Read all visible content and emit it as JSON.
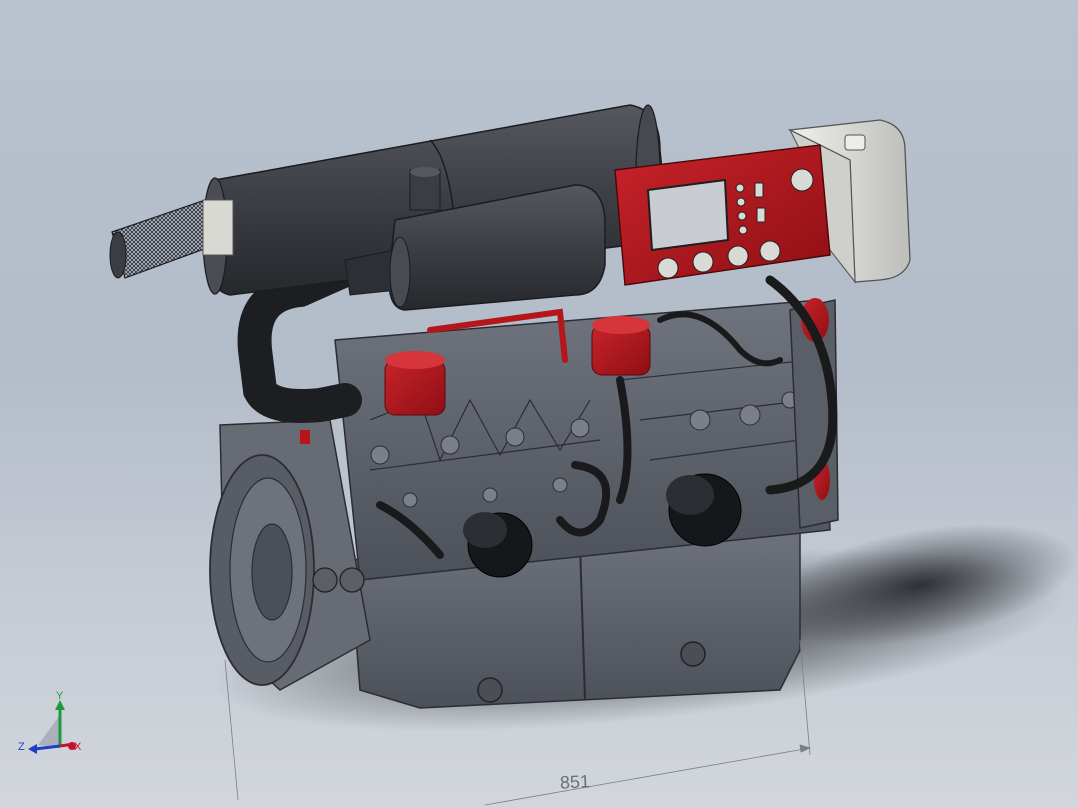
{
  "viewport": {
    "background_top": "#b9c2cf",
    "background_bottom": "#d2d6dc"
  },
  "model": {
    "colors": {
      "body": "#5c606a",
      "dark": "#2f3238",
      "muffler": "#3b3e44",
      "accent_red": "#b5161c",
      "hose": "#1a1a1d",
      "tank": "#d9d9d6",
      "screen": "#c9ccd0"
    }
  },
  "dimension": {
    "value": "851"
  },
  "triad": {
    "x_label": "X",
    "y_label": "Y",
    "z_label": "Z",
    "x_color": "#c8102e",
    "y_color": "#1f9a3a",
    "z_color": "#1c3fc4"
  }
}
